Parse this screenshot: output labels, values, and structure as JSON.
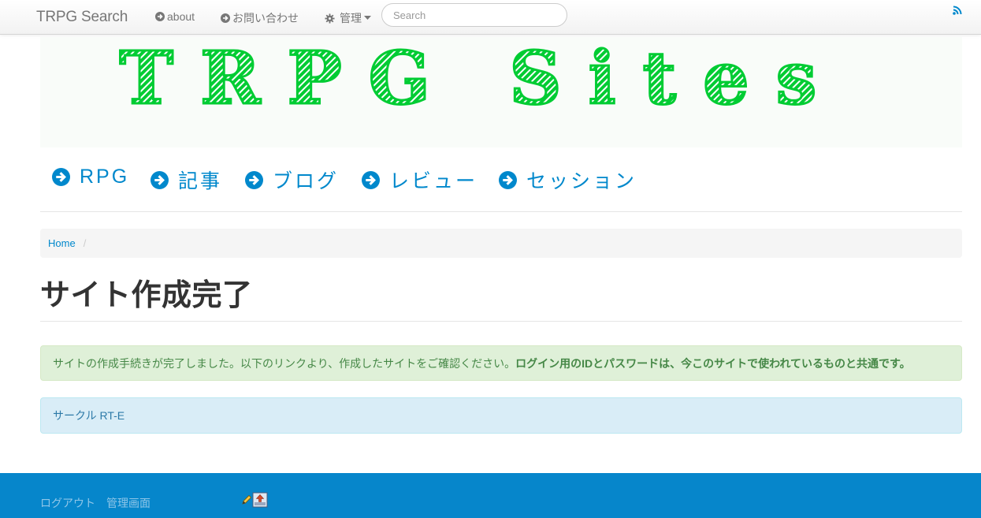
{
  "navbar": {
    "brand": "TRPG Search",
    "about_label": "about",
    "contact_label": "お問い合わせ",
    "admin_label": "管理",
    "search_placeholder": "Search"
  },
  "banner": {
    "text": "TRPG Sites",
    "color": "#00cc33"
  },
  "categories": [
    {
      "label": "RPG"
    },
    {
      "label": "記事"
    },
    {
      "label": "ブログ"
    },
    {
      "label": "レビュー"
    },
    {
      "label": "セッション"
    }
  ],
  "breadcrumb": {
    "home": "Home"
  },
  "page_title": "サイト作成完了",
  "success_alert": {
    "text": "サイトの作成手続きが完了しました。以下のリンクより、作成したサイトをご確認ください。",
    "bold_text": "ログイン用のIDとパスワードは、今このサイトで使われているものと共通です。"
  },
  "info_alert": {
    "link": "サークル RT-E"
  },
  "footer": {
    "logout": "ログアウト",
    "admin_screen": "管理画面"
  },
  "colors": {
    "link": "#0088cc",
    "footer_bg": "#0686cb",
    "success_bg": "#dff0d8",
    "info_bg": "#d9edf7"
  }
}
